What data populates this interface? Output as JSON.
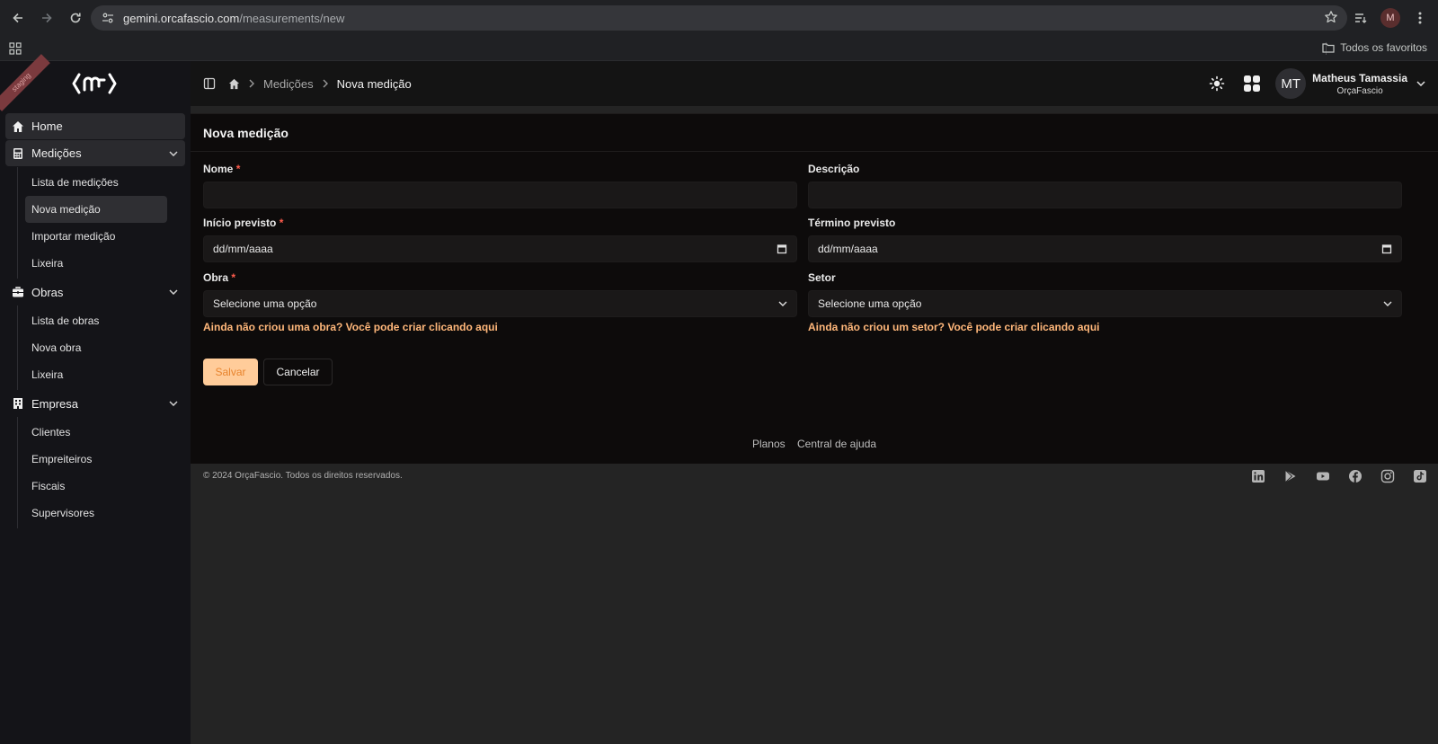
{
  "browser": {
    "url_host": "gemini.orcafascio.com",
    "url_path": "/measurements/new",
    "profile_initial": "M",
    "bookmarks_all": "Todos os favoritos"
  },
  "sidebar": {
    "ribbon": "staging",
    "home": "Home",
    "groups": [
      {
        "label": "Medições",
        "icon": "calculator-icon",
        "items": [
          "Lista de medições",
          "Nova medição",
          "Importar medição",
          "Lixeira"
        ]
      },
      {
        "label": "Obras",
        "icon": "briefcase-icon",
        "items": [
          "Lista de obras",
          "Nova obra",
          "Lixeira"
        ]
      },
      {
        "label": "Empresa",
        "icon": "building-icon",
        "items": [
          "Clientes",
          "Empreiteiros",
          "Fiscais",
          "Supervisores"
        ]
      }
    ]
  },
  "topbar": {
    "breadcrumb_section": "Medições",
    "breadcrumb_current": "Nova medição",
    "user_initials": "MT",
    "user_name": "Matheus Tamassia",
    "user_company": "OrçaFascio"
  },
  "form": {
    "title": "Nova medição",
    "nome_label": "Nome",
    "nome_value": "",
    "descricao_label": "Descrição",
    "descricao_value": "",
    "inicio_label": "Início previsto",
    "inicio_value": "dd/mm/aaaa",
    "termino_label": "Término previsto",
    "termino_value": "dd/mm/aaaa",
    "obra_label": "Obra",
    "obra_value": "Selecione uma opção",
    "obra_hint": "Ainda não criou uma obra? Você pode criar clicando aqui",
    "setor_label": "Setor",
    "setor_value": "Selecione uma opção",
    "setor_hint": "Ainda não criou um setor? Você pode criar clicando aqui",
    "required_mark": "*",
    "save_label": "Salvar",
    "cancel_label": "Cancelar"
  },
  "footer": {
    "links": [
      "Planos",
      "Central de ajuda"
    ],
    "copyright": "© 2024 OrçaFascio. Todos os direitos reservados.",
    "socials": [
      "linkedin-icon",
      "play-store-icon",
      "youtube-icon",
      "facebook-icon",
      "instagram-icon",
      "tiktok-icon"
    ]
  },
  "colors": {
    "accent": "#ffcc9a",
    "accent_text": "#e8842e",
    "hint": "#ffb77a",
    "required": "#ff5c4d"
  }
}
